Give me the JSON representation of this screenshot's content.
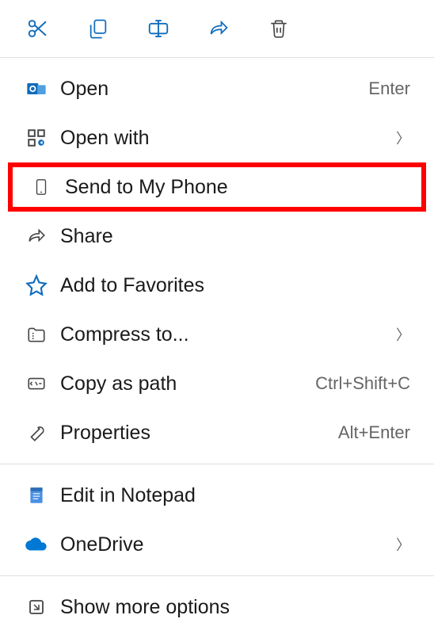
{
  "toolbar": {
    "cut": "cut",
    "copy": "copy",
    "rename": "rename",
    "share": "share",
    "delete": "delete"
  },
  "menu": {
    "open": {
      "label": "Open",
      "shortcut": "Enter"
    },
    "openWith": {
      "label": "Open with"
    },
    "sendToPhone": {
      "label": "Send to My Phone"
    },
    "share": {
      "label": "Share"
    },
    "addFavorites": {
      "label": "Add to Favorites"
    },
    "compress": {
      "label": "Compress to..."
    },
    "copyPath": {
      "label": "Copy as path",
      "shortcut": "Ctrl+Shift+C"
    },
    "properties": {
      "label": "Properties",
      "shortcut": "Alt+Enter"
    },
    "editNotepad": {
      "label": "Edit in Notepad"
    },
    "onedrive": {
      "label": "OneDrive"
    },
    "showMore": {
      "label": "Show more options"
    }
  },
  "colors": {
    "outlook_blue": "#0F6CBD",
    "onedrive_blue": "#0078D4",
    "notepad_blue": "#4A90E2"
  }
}
